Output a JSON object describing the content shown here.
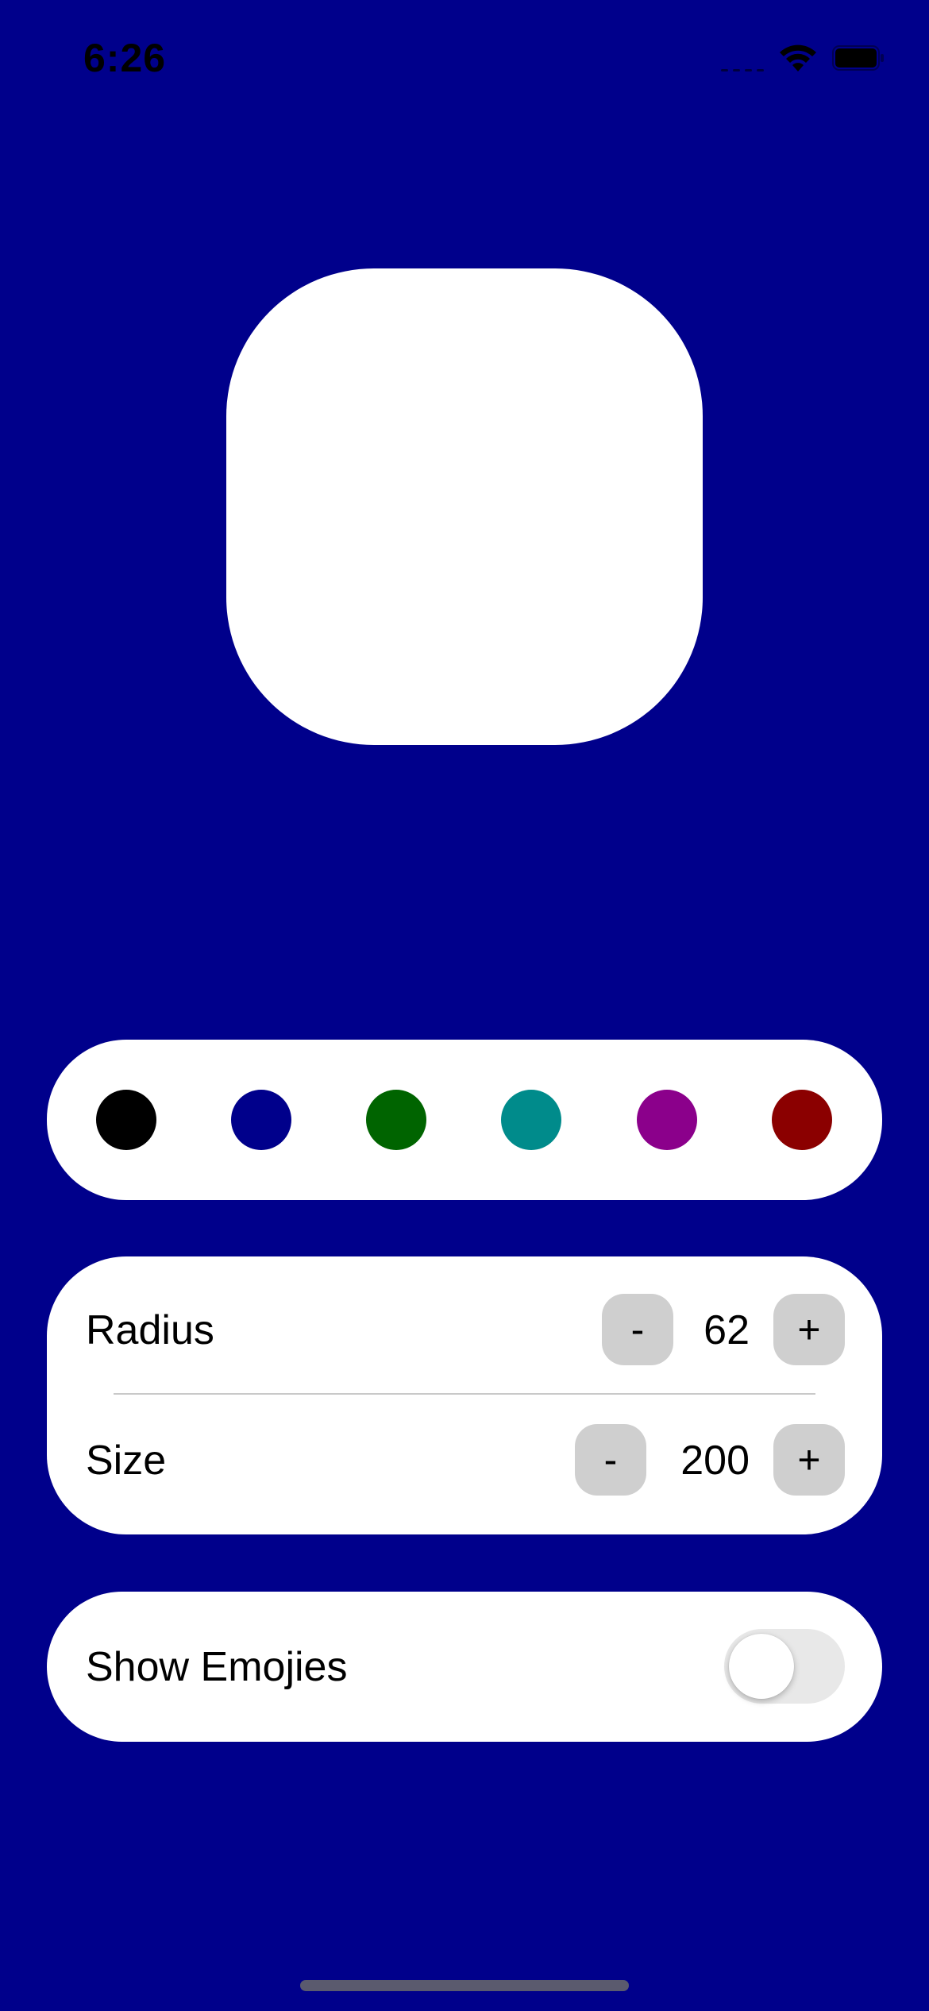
{
  "status_bar": {
    "time": "6:26",
    "icons": [
      "cellular-signal-icon",
      "wifi-icon",
      "battery-icon"
    ]
  },
  "preview": {
    "background_color": "#00008B",
    "shape_color": "#FFFFFF",
    "radius": 62,
    "size": 200
  },
  "colors": {
    "swatches": [
      {
        "name": "black",
        "hex": "#000000"
      },
      {
        "name": "navy",
        "hex": "#00008B"
      },
      {
        "name": "green",
        "hex": "#006400"
      },
      {
        "name": "teal",
        "hex": "#008B8B"
      },
      {
        "name": "purple",
        "hex": "#8B008B"
      },
      {
        "name": "dark-red",
        "hex": "#8B0000"
      }
    ]
  },
  "controls": {
    "radius": {
      "label": "Radius",
      "value": "62",
      "decrement_label": "-",
      "increment_label": "+"
    },
    "size": {
      "label": "Size",
      "value": "200",
      "decrement_label": "-",
      "increment_label": "+"
    }
  },
  "emoji_toggle": {
    "label": "Show Emojies",
    "on": false
  }
}
